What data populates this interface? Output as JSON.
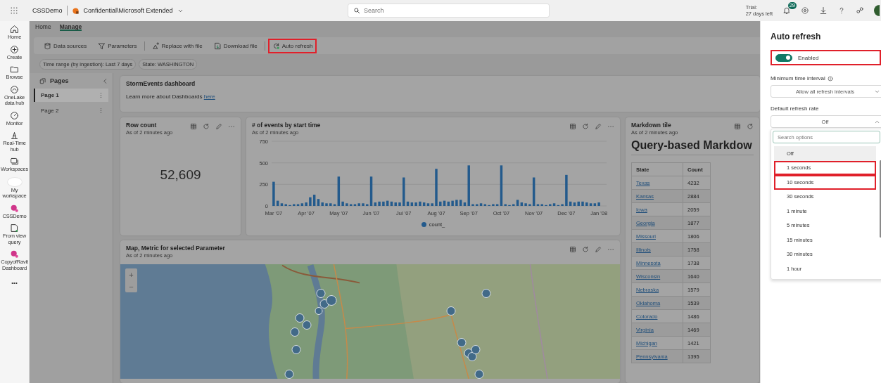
{
  "top_bar": {
    "app_name": "CSSDemo",
    "sensitivity": "Confidential\\Microsoft Extended",
    "search": {
      "placeholder": "Search"
    },
    "trial_label": "Trial:",
    "trial_days": "27 days left",
    "notification_count": "29"
  },
  "rail": [
    {
      "label": "Home"
    },
    {
      "label": "Create"
    },
    {
      "label": "Browse"
    },
    {
      "label": "OneLake data hub"
    },
    {
      "label": "Monitor"
    },
    {
      "label": "Real-Time hub"
    },
    {
      "label": "Workspaces"
    },
    {
      "label": "My workspace"
    },
    {
      "label": "CSSDemo"
    },
    {
      "label": "From view query"
    },
    {
      "label": "CopyofRavit Dashboard"
    }
  ],
  "rail_more": "•••",
  "tabs": [
    {
      "label": "Home",
      "selected": false
    },
    {
      "label": "Manage",
      "selected": true
    }
  ],
  "toolbar": [
    {
      "label": "Data sources",
      "highlighted": false
    },
    {
      "label": "Parameters",
      "highlighted": false
    },
    {
      "label": "Replace with file",
      "highlighted": false
    },
    {
      "label": "Download file",
      "highlighted": false
    },
    {
      "label": "Auto refresh",
      "highlighted": true
    }
  ],
  "filters": [
    "Time range (by ingestion): Last 7 days",
    "State: WASHINGTON"
  ],
  "pages": {
    "title": "Pages",
    "items": [
      {
        "label": "Page 1",
        "selected": true
      },
      {
        "label": "Page 2",
        "selected": false
      }
    ]
  },
  "intro_tile": {
    "title": "StormEvents dashboard",
    "text": "Learn more about Dashboards",
    "link": "here"
  },
  "row_count_tile": {
    "title": "Row count",
    "subtitle": "As of 2 minutes ago",
    "value": "52,609"
  },
  "events_tile": {
    "title": "# of events by start time",
    "subtitle": "As of 2 minutes ago",
    "chart_data": {
      "type": "bar",
      "categories": [
        "Mar '07",
        null,
        null,
        null,
        null,
        null,
        null,
        null,
        "Apr '07",
        null,
        null,
        null,
        null,
        null,
        null,
        null,
        "May '07",
        null,
        null,
        null,
        null,
        null,
        null,
        null,
        "Jun '07",
        null,
        null,
        null,
        null,
        null,
        null,
        null,
        "Jul '07",
        null,
        null,
        null,
        null,
        null,
        null,
        null,
        "Aug '07",
        null,
        null,
        null,
        null,
        null,
        null,
        null,
        "Sep '07",
        null,
        null,
        null,
        null,
        null,
        null,
        null,
        "Oct '07",
        null,
        null,
        null,
        null,
        null,
        null,
        null,
        "Nov '07",
        null,
        null,
        null,
        null,
        null,
        null,
        null,
        "Dec '07",
        null,
        null,
        null,
        null,
        null,
        null,
        null,
        "Jan '08"
      ],
      "series": [
        {
          "name": "count_",
          "color": "#235a8c",
          "values": [
            280,
            60,
            30,
            20,
            10,
            20,
            20,
            30,
            40,
            100,
            130,
            80,
            40,
            30,
            30,
            20,
            340,
            50,
            30,
            20,
            20,
            30,
            30,
            20,
            340,
            40,
            50,
            50,
            60,
            50,
            40,
            40,
            330,
            50,
            40,
            40,
            50,
            40,
            30,
            30,
            430,
            50,
            60,
            50,
            60,
            70,
            70,
            40,
            470,
            20,
            20,
            30,
            20,
            10,
            20,
            20,
            470,
            20,
            10,
            20,
            70,
            40,
            30,
            20,
            330,
            20,
            20,
            10,
            20,
            30,
            10,
            20,
            360,
            50,
            40,
            50,
            50,
            40,
            30,
            30,
            40
          ]
        }
      ],
      "ylim": [
        0,
        750
      ],
      "yticks": [
        0,
        250,
        500,
        750
      ]
    }
  },
  "markdown_tile": {
    "title": "Markdown tile",
    "subtitle": "As of 2 minutes ago",
    "heading": "Query-based Markdow",
    "columns": [
      "State",
      "Count"
    ],
    "rows": [
      [
        "Texas",
        "4232"
      ],
      [
        "Kansas",
        "2884"
      ],
      [
        "Iowa",
        "2059"
      ],
      [
        "Georgia",
        "1877"
      ],
      [
        "Missouri",
        "1806"
      ],
      [
        "Illinois",
        "1758"
      ],
      [
        "Minnesota",
        "1738"
      ],
      [
        "Wisconsin",
        "1640"
      ],
      [
        "Nebraska",
        "1579"
      ],
      [
        "Oklahoma",
        "1539"
      ],
      [
        "Colorado",
        "1486"
      ],
      [
        "Virginia",
        "1469"
      ],
      [
        "Michigan",
        "1421"
      ],
      [
        "Pennsylvania",
        "1395"
      ]
    ]
  },
  "map_tile": {
    "title": "Map, Metric for selected Parameter",
    "subtitle": "As of 2 minutes ago",
    "zoom_in": "+",
    "zoom_out": "−"
  },
  "auto_refresh_panel": {
    "title": "Auto refresh",
    "toggle": {
      "label": "Enabled",
      "on": true,
      "highlighted": true
    },
    "min_interval": {
      "label": "Minimum time interval",
      "value": "Allow all refresh intervals"
    },
    "default_rate": {
      "label": "Default refresh rate",
      "value": "Off",
      "expanded": true
    },
    "search": {
      "placeholder": "Search options"
    },
    "options": [
      {
        "label": "Off",
        "selected": true,
        "highlighted": false
      },
      {
        "label": "1 seconds",
        "selected": false,
        "highlighted": true
      },
      {
        "label": "10 seconds",
        "selected": false,
        "highlighted": true
      },
      {
        "label": "30 seconds",
        "selected": false,
        "highlighted": false
      },
      {
        "label": "1 minute",
        "selected": false,
        "highlighted": false
      },
      {
        "label": "5 minutes",
        "selected": false,
        "highlighted": false
      },
      {
        "label": "15 minutes",
        "selected": false,
        "highlighted": false
      },
      {
        "label": "30 minutes",
        "selected": false,
        "highlighted": false
      },
      {
        "label": "1 hour",
        "selected": false,
        "highlighted": false
      }
    ]
  }
}
